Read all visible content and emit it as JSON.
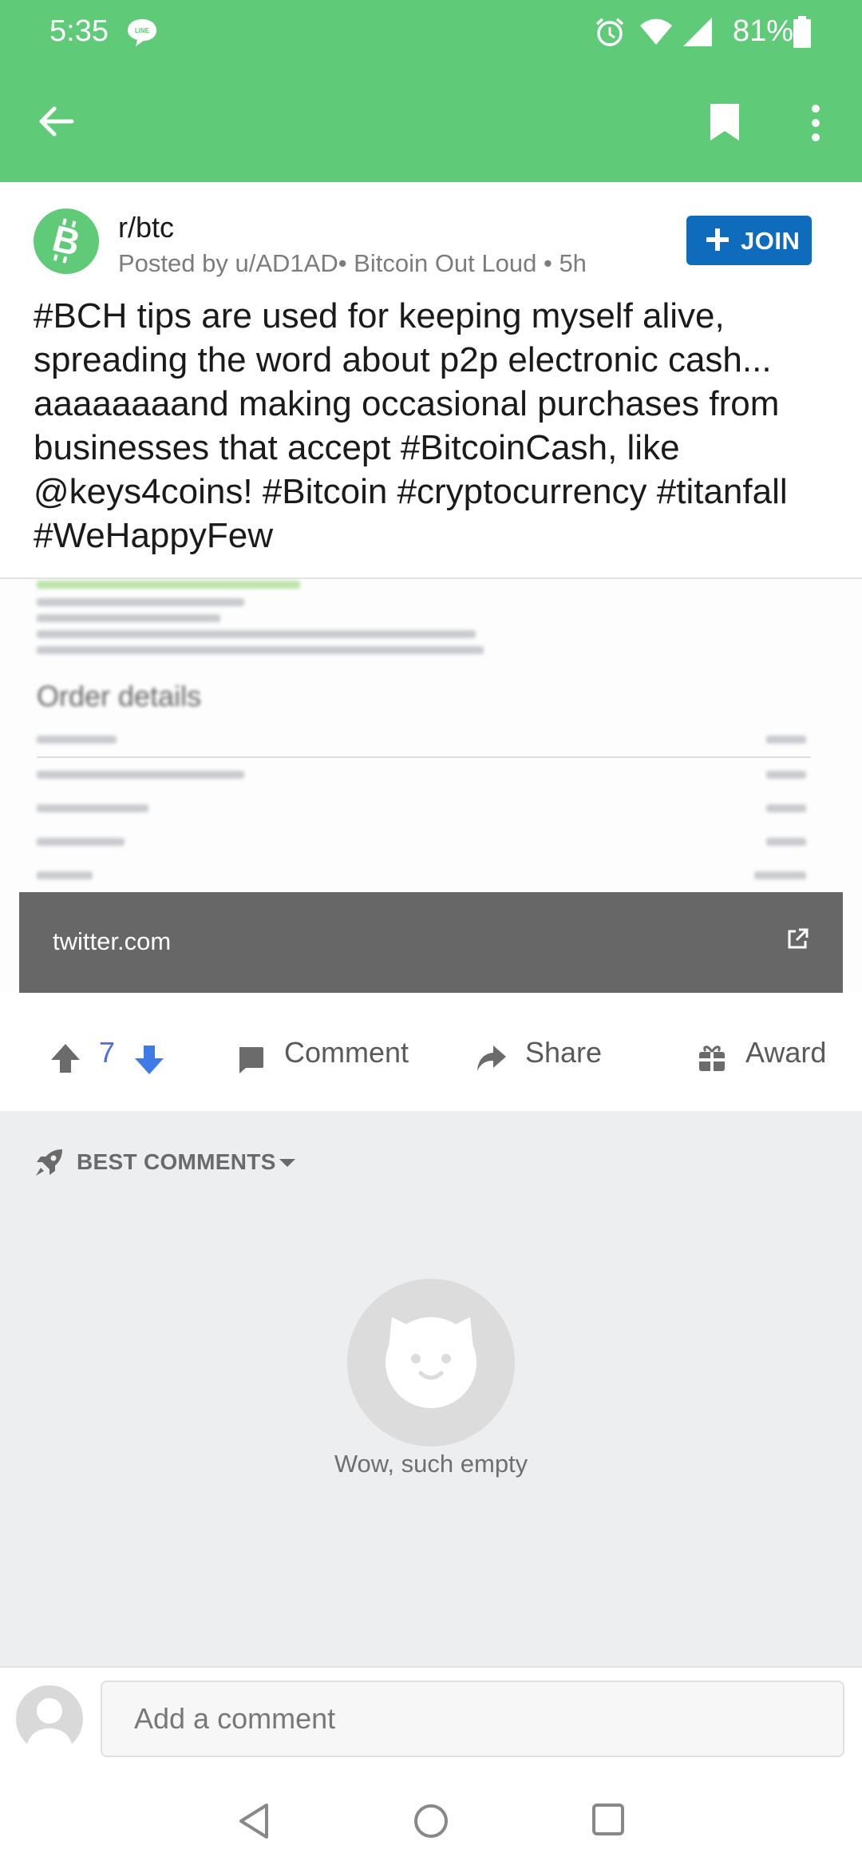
{
  "status_bar": {
    "time": "5:35",
    "battery": "81%"
  },
  "post": {
    "subreddit": "r/btc",
    "meta": "Posted by u/AD1AD• Bitcoin Out Loud • 5h",
    "join_label": "JOIN",
    "title": "#BCH tips are used for keeping myself alive, spreading the word about p2p electronic cash... aaaaaaaand making occasional purchases from businesses that accept #BitcoinCash, like @keys4coins! #Bitcoin #cryptocurrency #titanfall #WeHappyFew",
    "link_preview": {
      "heading": "Order details",
      "domain": "twitter.com"
    }
  },
  "actions": {
    "vote_count": "7",
    "comment_label": "Comment",
    "share_label": "Share",
    "award_label": "Award"
  },
  "comments": {
    "sort_label": "BEST COMMENTS",
    "empty_text": "Wow, such empty"
  },
  "composer": {
    "placeholder": "Add a comment"
  },
  "colors": {
    "header_green": "#5fca77",
    "join_blue": "#0f6cbd",
    "upvote_grey": "#6b6b6b",
    "downvote_blue": "#3f7be6"
  },
  "icons": [
    "line-chat-icon",
    "alarm-icon",
    "wifi-icon",
    "signal-icon",
    "battery-icon",
    "back-arrow-icon",
    "bookmark-icon",
    "overflow-menu-icon",
    "bitcoin-cash-icon",
    "plus-icon",
    "external-link-icon",
    "upvote-icon",
    "downvote-icon",
    "comment-icon",
    "share-icon",
    "award-icon",
    "rocket-icon",
    "chevron-down-icon",
    "cat-icon",
    "user-avatar-icon",
    "nav-back-icon",
    "nav-home-icon",
    "nav-recents-icon"
  ]
}
